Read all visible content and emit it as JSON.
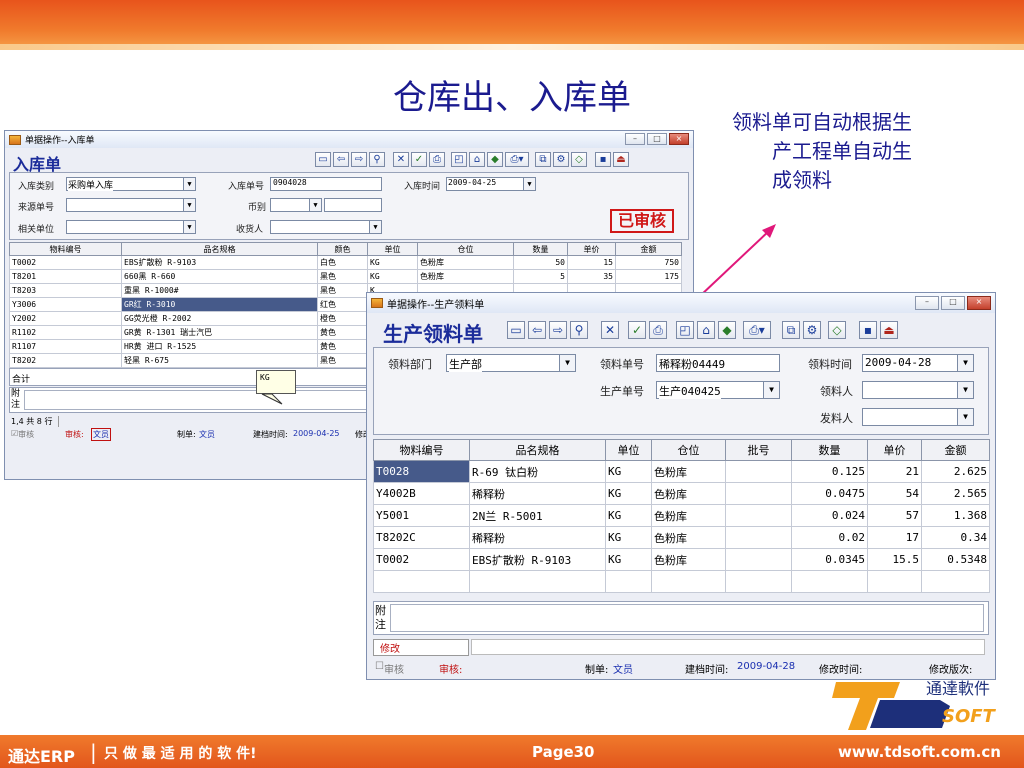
{
  "slide": {
    "title": "仓库出、入库单",
    "note_line1": "领料单可自动根据生",
    "note_line2": "产工程单自动生",
    "note_line3": "成领料"
  },
  "in_window": {
    "title": "单据操作--入库单",
    "form_name": "入库单",
    "fields": {
      "type_label": "入库类别",
      "type_value": "采购单入库",
      "no_label": "入库单号",
      "no_value": "0904028",
      "time_label": "入库时间",
      "time_value": "2009-04-25",
      "source_label": "来源单号",
      "source_value": "",
      "currency_label": "币别",
      "currency_value": "",
      "unit_label": "相关单位",
      "unit_value": "",
      "receiver_label": "收货人",
      "receiver_value": ""
    },
    "stamp": "已审核",
    "columns": [
      "物料编号",
      "品名规格",
      "颜色",
      "单位",
      "仓位",
      "数量",
      "单价",
      "金额"
    ],
    "rows": [
      [
        "T0002",
        "EBS扩散粉  R-9103",
        "白色",
        "KG",
        "色粉库",
        "50",
        "15",
        "750"
      ],
      [
        "T8201",
        "660黑  R-660",
        "黑色",
        "KG",
        "色粉库",
        "5",
        "35",
        "175"
      ],
      [
        "T8203",
        "重黑  R-1000#",
        "黑色",
        "K",
        "",
        "",
        "",
        ""
      ],
      [
        "Y3006",
        "GR红  R-3010",
        "红色",
        "K",
        "",
        "",
        "",
        ""
      ],
      [
        "Y2002",
        "GG荧光橙  R-2002",
        "橙色",
        "K",
        "",
        "",
        "",
        ""
      ],
      [
        "R1102",
        "GR黄  R-1301   瑞士汽巴",
        "黄色",
        "K",
        "",
        "",
        "",
        ""
      ],
      [
        "R1107",
        "HR黄   进口  R-1525",
        "黄色",
        "K",
        "",
        "",
        "",
        ""
      ],
      [
        "T8202",
        "轻黑  R-675",
        "黑色",
        "K",
        "",
        "",
        "",
        ""
      ]
    ],
    "total_label": "合计",
    "remark_label": "附注",
    "row_status": "1,4 共 8 行",
    "tooltip": "KG",
    "status": {
      "audit_chk": "审核",
      "auditor_label": "审核:",
      "auditor": "文员",
      "maker_label": "制单:",
      "maker": "文员",
      "created_label": "建档时间:",
      "created": "2009-04-25",
      "mod_label": "修改"
    }
  },
  "out_window": {
    "title": "单据操作--生产领料单",
    "form_name": "生产领料单",
    "fields": {
      "dept_label": "领料部门",
      "dept_value": "生产部",
      "no_label": "领料单号",
      "no_value": "稀释粉04449",
      "time_label": "领料时间",
      "time_value": "2009-04-28",
      "prod_label": "生产单号",
      "prod_value": "生产040425",
      "taker_label": "领料人",
      "taker_value": "",
      "issuer_label": "发料人",
      "issuer_value": ""
    },
    "columns": [
      "物料编号",
      "品名规格",
      "单位",
      "仓位",
      "批号",
      "数量",
      "单价",
      "金额"
    ],
    "rows": [
      [
        "T0028",
        "R-69   钛白粉",
        "KG",
        "色粉库",
        "",
        "0.125",
        "21",
        "2.625"
      ],
      [
        "Y4002B",
        "稀释粉",
        "KG",
        "色粉库",
        "",
        "0.0475",
        "54",
        "2.565"
      ],
      [
        "Y5001",
        "2N兰   R-5001",
        "KG",
        "色粉库",
        "",
        "0.024",
        "57",
        "1.368"
      ],
      [
        "T8202C",
        "稀释粉",
        "KG",
        "色粉库",
        "",
        "0.02",
        "17",
        "0.34"
      ],
      [
        "T0002",
        "EBS扩散粉   R-9103",
        "KG",
        "色粉库",
        "",
        "0.0345",
        "15.5",
        "0.5348"
      ]
    ],
    "remark_label": "附注",
    "edit_label": "修改",
    "status": {
      "audit_chk": "审核",
      "auditor_label": "审核:",
      "maker_label": "制单:",
      "maker": "文员",
      "created_label": "建档时间:",
      "created": "2009-04-28",
      "mod_time_label": "修改时间:",
      "mod_ver_label": "修改版次:"
    }
  },
  "footer": {
    "brand": "通达ERP",
    "slogan": "只 做 最 适 用 的 软 件!",
    "page": "Page30",
    "url": "www.tdsoft.com.cn",
    "logo_cn": "通達軟件",
    "logo_en": "SOFT"
  },
  "colors": {
    "title_blue": "#1b1b8f",
    "band_orange": "#e8541c",
    "stamp_red": "#d01818",
    "arrow": "#e0187a"
  },
  "icons": [
    "new-icon",
    "prev-icon",
    "next-icon",
    "find-icon",
    "delete-icon",
    "check-icon",
    "print-icon",
    "preview-icon",
    "export-icon",
    "approve-icon",
    "printer-dropdown-icon",
    "copy-icon",
    "settings-icon",
    "tag-icon",
    "save-icon",
    "exit-icon"
  ]
}
